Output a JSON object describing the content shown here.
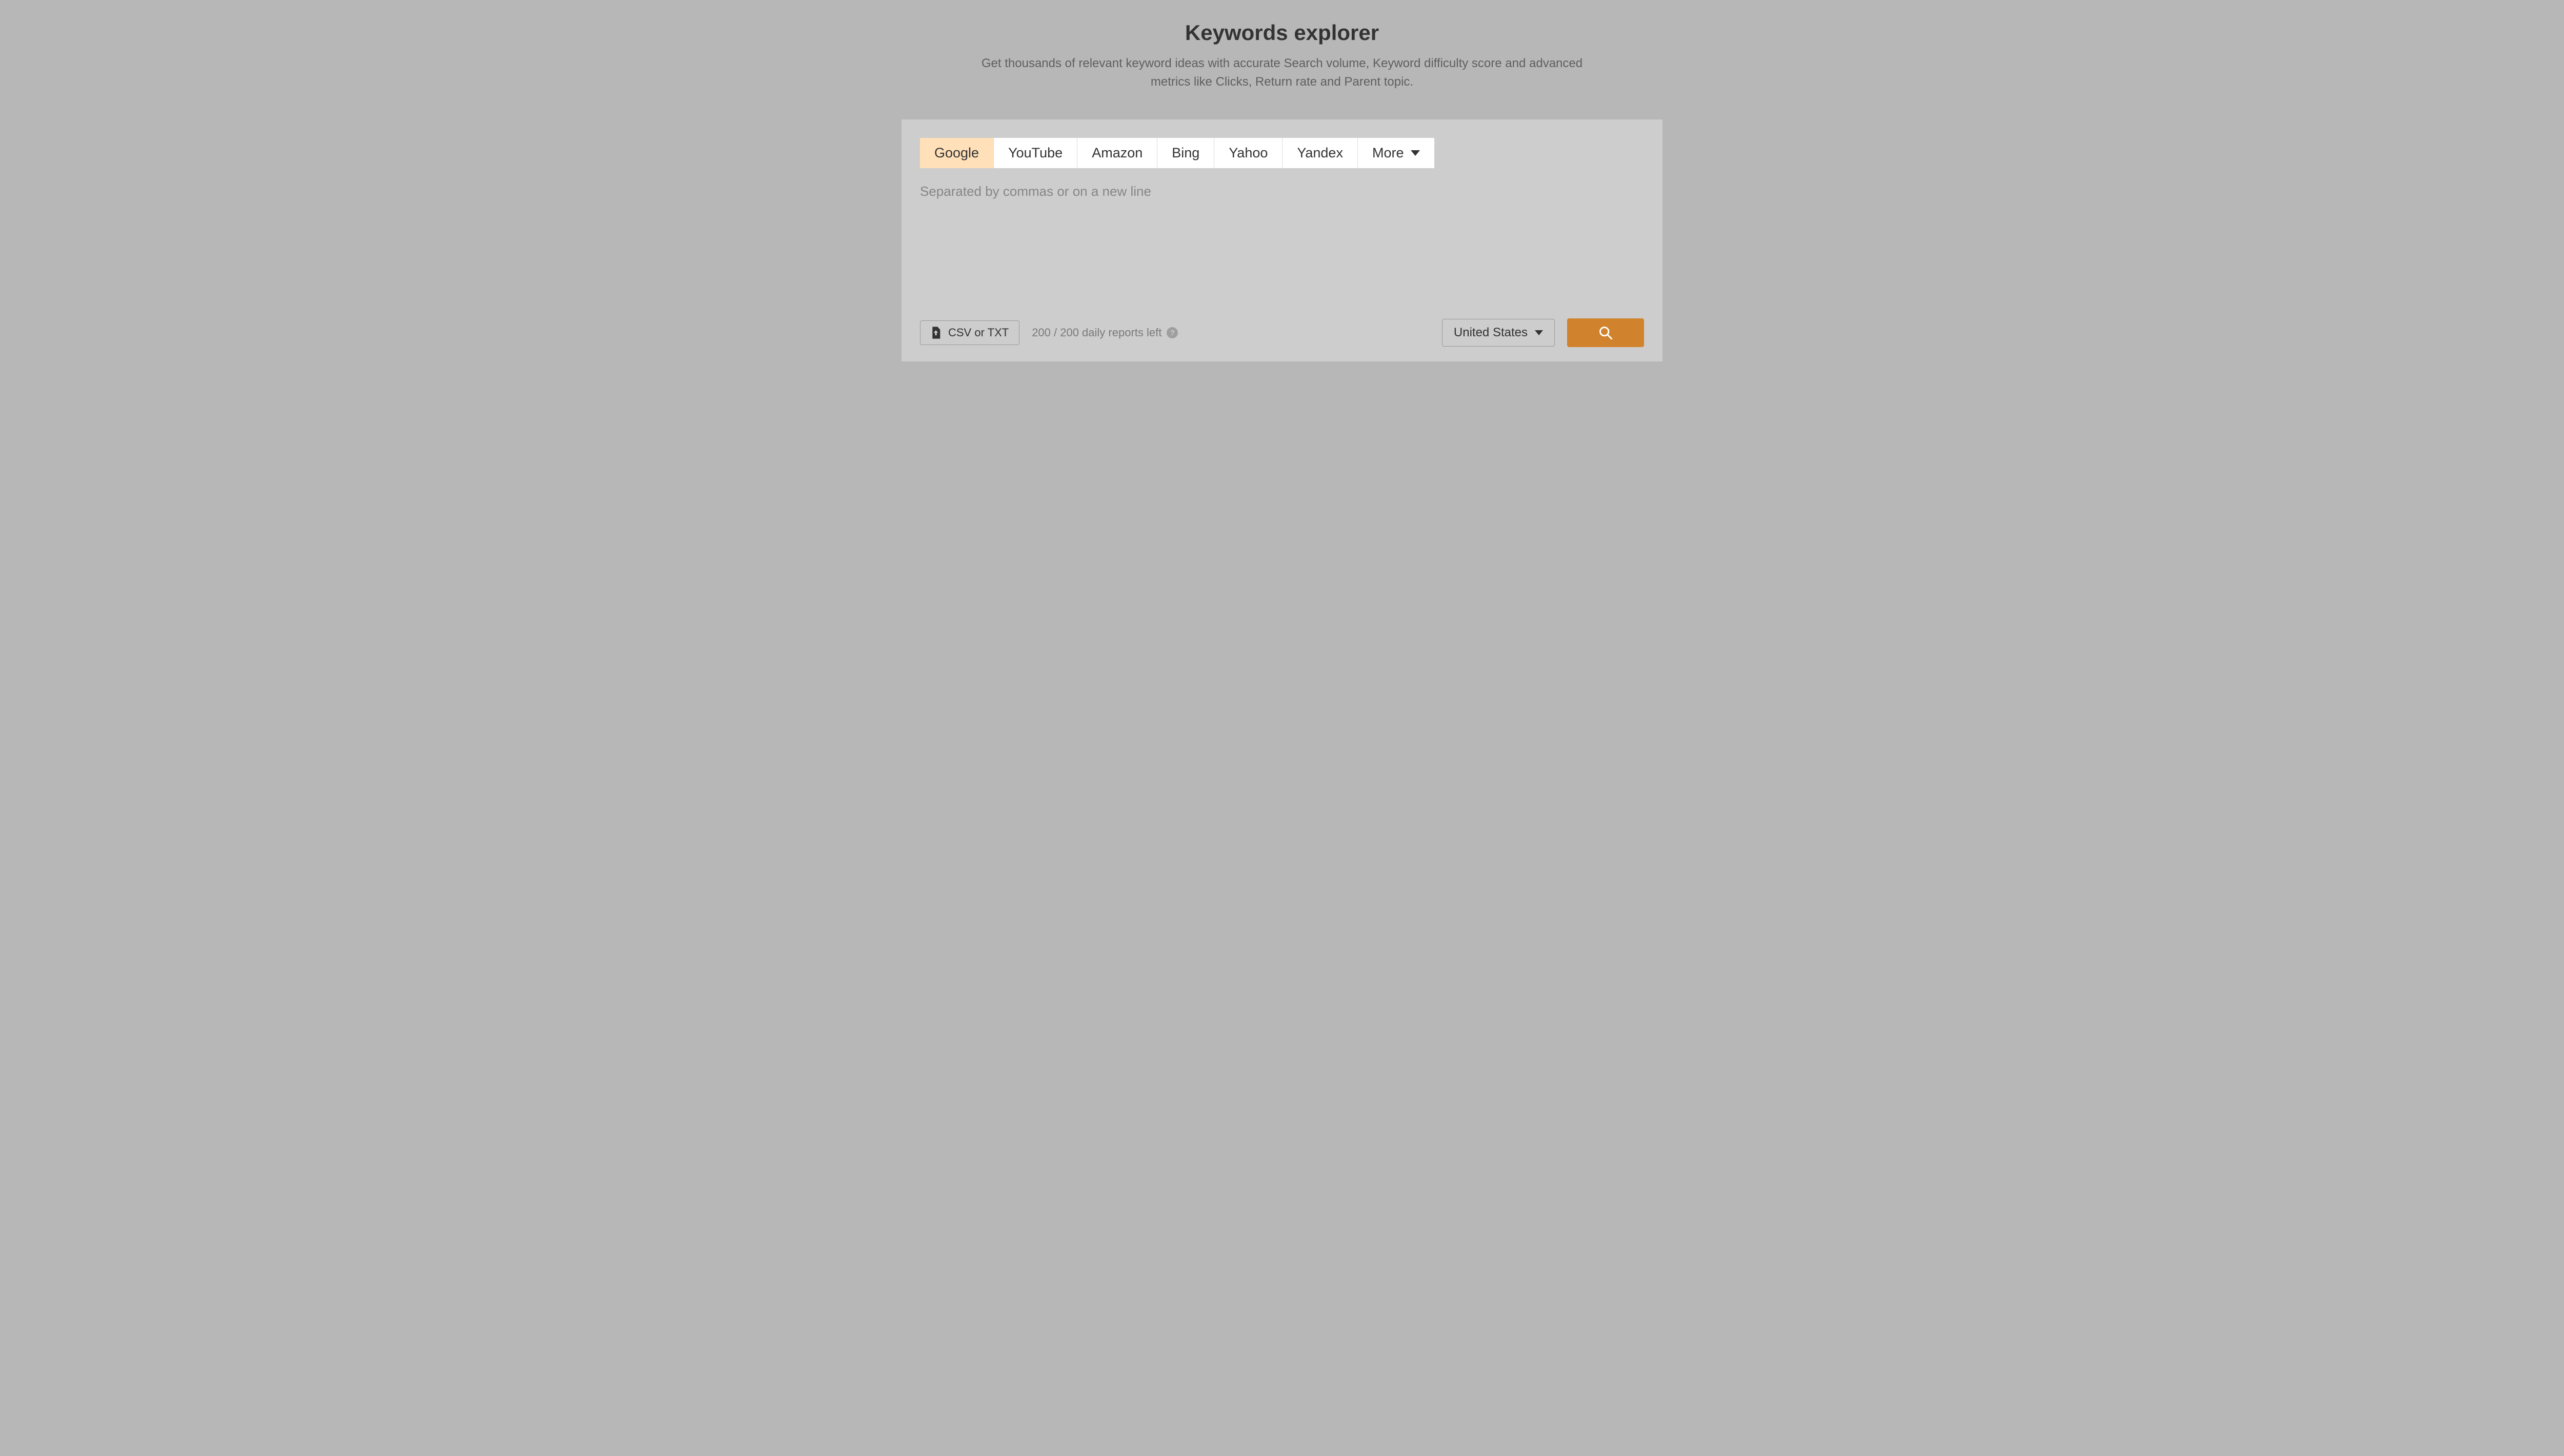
{
  "header": {
    "title": "Keywords explorer",
    "subtitle": "Get thousands of relevant keyword ideas with accurate Search volume, Keyword difficulty score and advanced metrics like Clicks, Return rate and Parent topic."
  },
  "engines": {
    "items": [
      {
        "label": "Google",
        "active": true
      },
      {
        "label": "YouTube",
        "active": false
      },
      {
        "label": "Amazon",
        "active": false
      },
      {
        "label": "Bing",
        "active": false
      },
      {
        "label": "Yahoo",
        "active": false
      },
      {
        "label": "Yandex",
        "active": false
      }
    ],
    "more_label": "More"
  },
  "input": {
    "placeholder": "Separated by commas or on a new line",
    "value": ""
  },
  "footer": {
    "upload_label": "CSV or TXT",
    "reports_left": "200 / 200 daily reports left",
    "country": "United States"
  }
}
